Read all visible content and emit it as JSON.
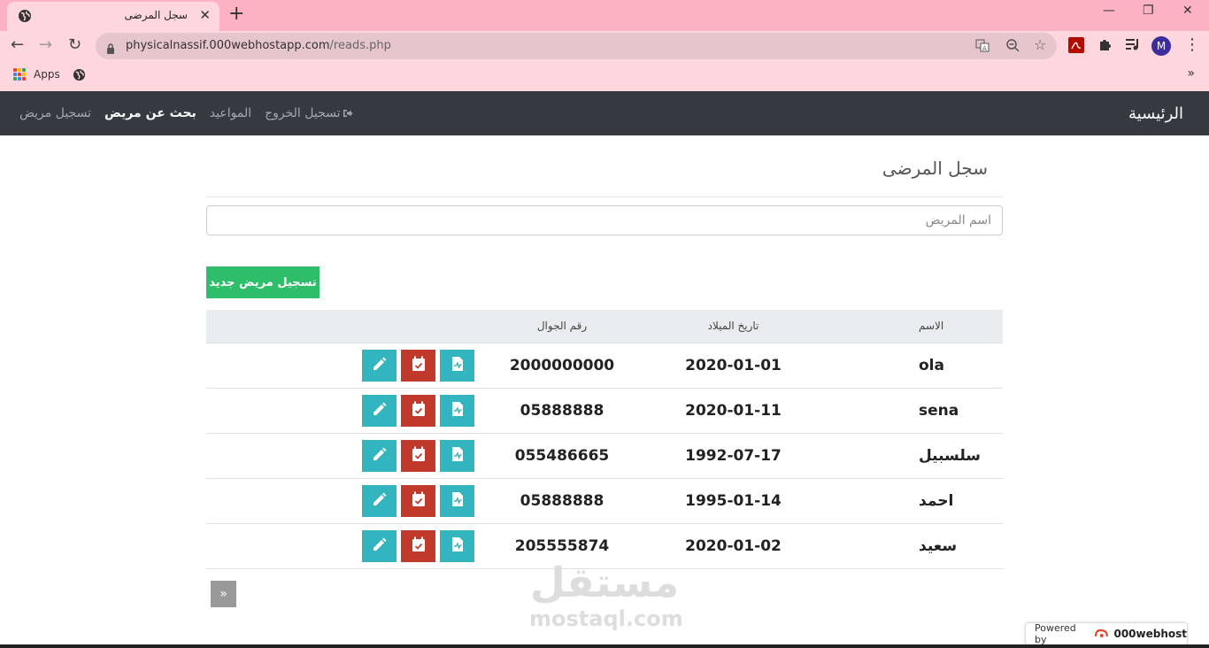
{
  "browser": {
    "tab_title": "سجل المرضى",
    "url_host": "physicalnassif.000webhostapp.com",
    "url_path": "/reads.php",
    "avatar_initial": "M",
    "bookmarks": {
      "apps_label": "Apps"
    }
  },
  "navbar": {
    "brand": "الرئيسية",
    "links": [
      "تسجيل مريض",
      "بحث عن مريض",
      "المواعيد",
      "تسجيل الخروج"
    ],
    "active_link": "بحث عن مريض"
  },
  "page": {
    "title": "سجل المرضى",
    "search_placeholder": "اسم المريض",
    "new_patient_button": "تسجيل مريض جديد"
  },
  "table": {
    "headers": {
      "name": "الاسم",
      "dob": "تاريخ الميلاد",
      "phone": "رقم الجوال"
    },
    "rows": [
      {
        "name": "ola",
        "dob": "2020-01-01",
        "phone": "2000000000"
      },
      {
        "name": "sena",
        "dob": "2020-01-11",
        "phone": "05888888"
      },
      {
        "name": "سلسبيل",
        "dob": "1992-07-17",
        "phone": "055486665"
      },
      {
        "name": "احمد",
        "dob": "1995-01-14",
        "phone": "05888888"
      },
      {
        "name": "سعيد",
        "dob": "2020-01-02",
        "phone": "205555874"
      }
    ]
  },
  "pager": {
    "next_label": "»"
  },
  "watermark": {
    "arabic": "مستقل",
    "latin": "mostaql.com"
  },
  "powered_by": {
    "prefix": "Powered by",
    "brand": "000webhost"
  },
  "colors": {
    "navbar": "#343a40",
    "success": "#2ebd68",
    "info": "#33b5bf",
    "danger": "#c0392b",
    "chrome_tab": "#fcb2c2"
  }
}
